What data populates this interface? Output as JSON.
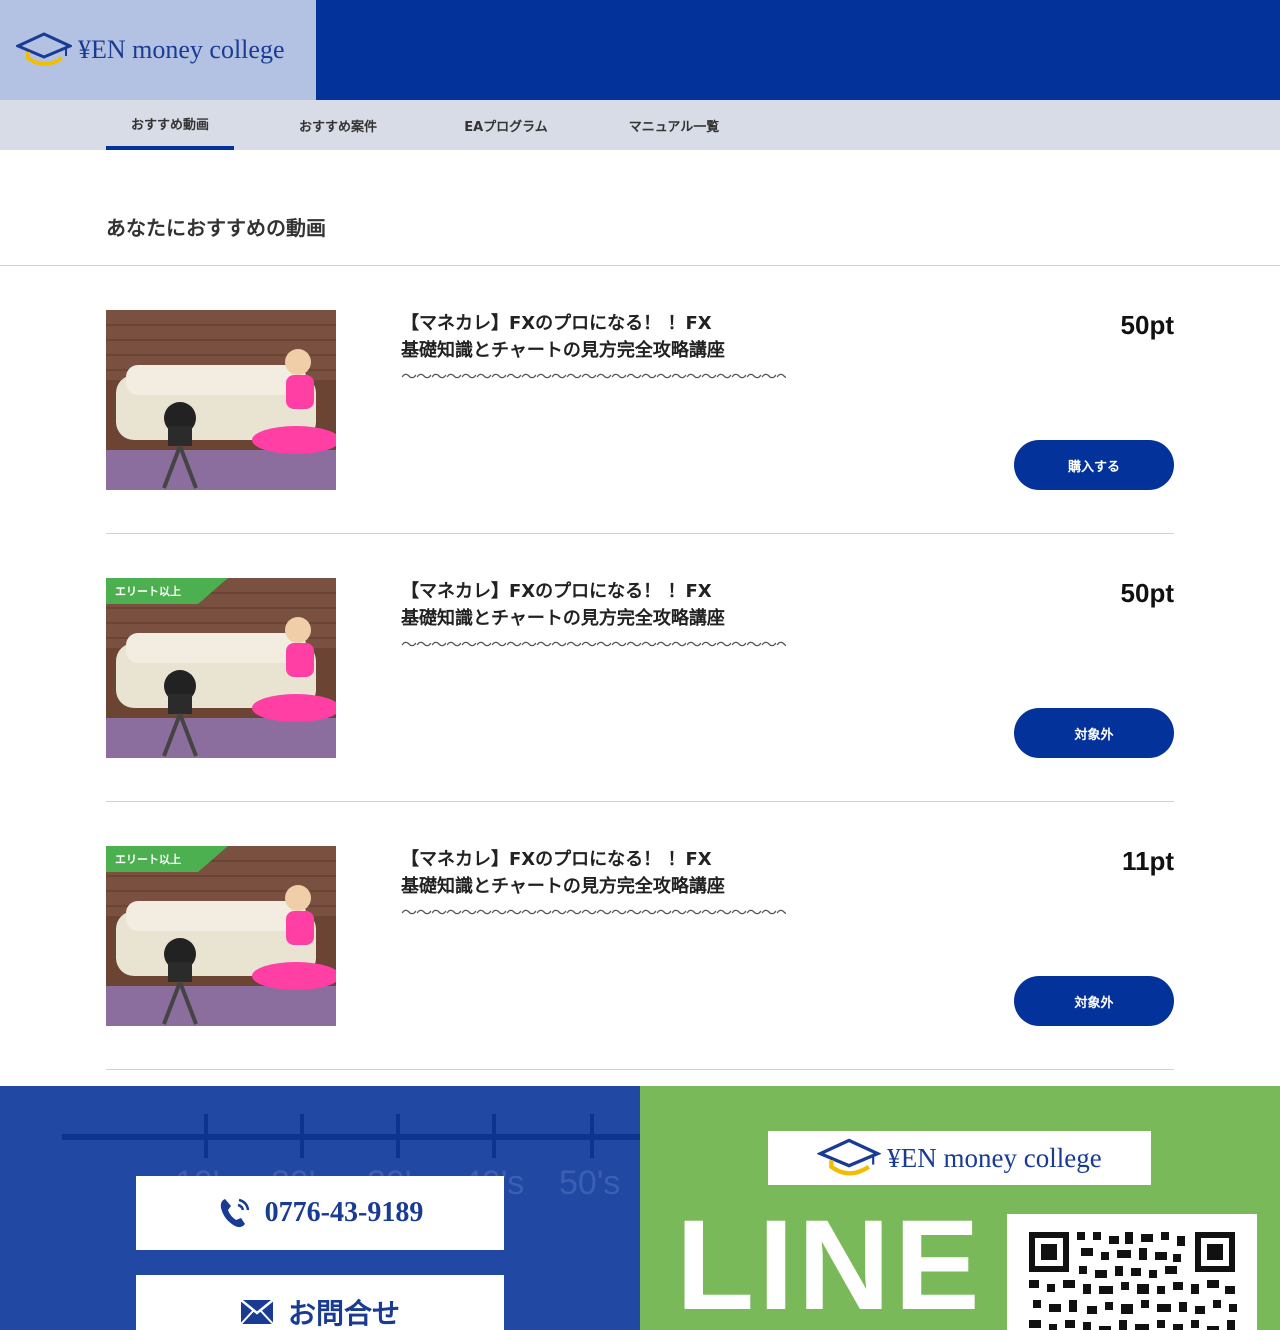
{
  "header": {
    "logo_text": "¥EN money college"
  },
  "nav": {
    "tabs": [
      {
        "label": "おすすめ動画",
        "active": true
      },
      {
        "label": "おすすめ案件",
        "active": false
      },
      {
        "label": "EAプログラム",
        "active": false
      },
      {
        "label": "マニュアル一覧",
        "active": false
      }
    ]
  },
  "section": {
    "title": "あなたにおすすめの動画"
  },
  "items": [
    {
      "title": "【マネカレ】FXのプロになる！ ！FX\n基礎知識とチャートの見方完全攻略講座",
      "description": "〜〜〜〜〜〜〜〜〜〜〜〜〜〜〜〜〜〜〜〜〜〜〜〜〜〜〜〜〜〜〜〜〜〜〜〜〜〜〜〜〜〜〜〜〜〜〜〜〜〜〜〜〜〜〜〜〜〜〜〜〜〜〜〜〜〜〜〜〜〜〜〜〜〜〜〜〜〜〜〜〜〜〜〜〜〜〜〜〜〜〜〜〜〜〜〜〜〜〜〜〜〜〜〜〜〜〜〜〜〜〜〜〜〜〜〜〜〜〜〜〜〜〜〜〜〜〜〜〜〜〜〜〜〜〜〜〜〜〜〜〜…",
      "price": "50pt",
      "button": "購入する",
      "badge": ""
    },
    {
      "title": "【マネカレ】FXのプロになる！ ！FX\n基礎知識とチャートの見方完全攻略講座",
      "description": "〜〜〜〜〜〜〜〜〜〜〜〜〜〜〜〜〜〜〜〜〜〜〜〜〜〜〜〜〜〜〜〜〜〜〜〜〜〜〜〜〜〜〜〜〜〜〜〜〜〜〜〜〜〜〜〜〜〜〜〜〜〜〜〜〜〜〜〜〜〜〜〜〜〜〜〜〜〜〜〜〜〜〜〜〜〜〜〜〜〜〜〜〜〜〜〜〜〜〜〜〜〜〜〜〜〜〜〜〜〜〜〜〜〜〜〜〜〜〜〜〜〜〜〜〜〜〜〜〜〜〜〜〜〜〜〜〜〜〜〜…",
      "price": "50pt",
      "button": "対象外",
      "badge": "エリート以上"
    },
    {
      "title": "【マネカレ】FXのプロになる！ ！FX\n基礎知識とチャートの見方完全攻略講座",
      "description": "〜〜〜〜〜〜〜〜〜〜〜〜〜〜〜〜〜〜〜〜〜〜〜〜〜〜〜〜〜〜〜〜〜〜〜〜〜〜〜〜〜〜〜〜〜〜〜〜〜〜〜〜〜〜〜〜〜〜〜〜〜〜〜〜〜〜〜〜〜〜〜〜〜〜〜〜〜〜〜〜〜〜〜〜〜〜〜〜〜〜〜〜〜〜〜〜〜〜〜〜〜〜〜〜〜〜〜〜〜〜〜〜〜〜〜〜〜〜〜〜〜〜〜〜〜〜〜〜〜〜〜〜〜〜〜〜〜〜〜〜…",
      "price": "11pt",
      "button": "対象外",
      "badge": "エリート以上"
    }
  ],
  "footer": {
    "deco_labels": [
      "10's",
      "20's",
      "30's",
      "40's",
      "50's"
    ],
    "phone": "0776-43-9189",
    "contact": "お問合せ",
    "line_logo_text": "¥EN money college",
    "line_word": "LINE"
  },
  "colors": {
    "primary": "#03339a",
    "logo_bg": "#b3c2e2",
    "nav_bg": "#d8dce6",
    "footer_blue": "#2148a2",
    "line_green": "#7ab95a",
    "badge_green": "#4caf50",
    "logo_gold": "#f0c000"
  },
  "icons": {
    "logo": "mortarboard-icon",
    "phone": "phone-icon",
    "mail": "mail-icon",
    "qr": "qr-code"
  }
}
